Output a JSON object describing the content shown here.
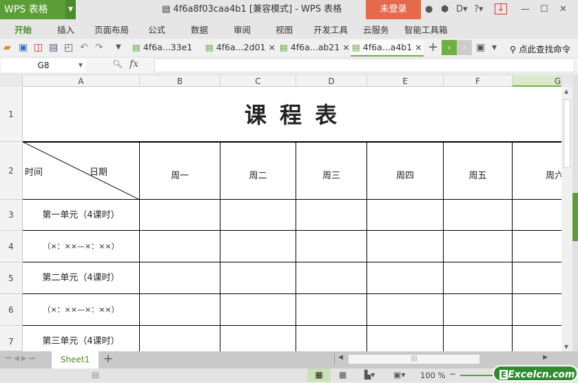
{
  "app": {
    "logo": "WPS 表格",
    "doc_title": "4f6a8f03caa4b1 [兼容模式] - WPS 表格",
    "login": "未登录"
  },
  "menu": [
    "开始",
    "插入",
    "页面布局",
    "公式",
    "数据",
    "审阅",
    "视图",
    "开发工具",
    "云服务",
    "智能工具箱"
  ],
  "doc_tabs": [
    "4f6a...33e1",
    "4f6a...2d01",
    "4f6a...ab21",
    "4f6a...a4b1"
  ],
  "search_cmd": "点此查找命令",
  "namebox": "G8",
  "fx": "fx",
  "columns": [
    "A",
    "B",
    "C",
    "D",
    "E",
    "F",
    "G"
  ],
  "rows": [
    "1",
    "2",
    "3",
    "4",
    "5",
    "6",
    "7"
  ],
  "sheet": {
    "title": "课 程 表",
    "diag_left": "时间",
    "diag_right": "日期",
    "days": [
      "周一",
      "周二",
      "周三",
      "周四",
      "周五",
      "周六"
    ],
    "row_labels": [
      "第一单元（4课时）",
      "（×：××—×：××）",
      "第二单元（4课时）",
      "（×：××—×：××）",
      "第三单元（4课时）"
    ]
  },
  "sheet_tab": "Sheet1",
  "status": {
    "zoom": "100 %",
    "watermark": "Excelcn.com"
  },
  "colors": {
    "accent": "#5a9e35",
    "login": "#e46a4b"
  }
}
